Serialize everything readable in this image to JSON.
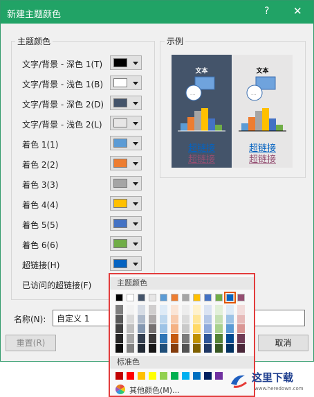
{
  "window": {
    "title": "新建主题颜色",
    "help_label": "?",
    "close_label": "✕"
  },
  "theme_group": {
    "title": "主题颜色",
    "rows": [
      {
        "label": "文字/背景 - 深色 1(T)",
        "color": "#000000"
      },
      {
        "label": "文字/背景 - 浅色 1(B)",
        "color": "#ffffff"
      },
      {
        "label": "文字/背景 - 深色 2(D)",
        "color": "#44546a"
      },
      {
        "label": "文字/背景 - 浅色 2(L)",
        "color": "#e7e6e6"
      },
      {
        "label": "着色 1(1)",
        "color": "#5b9bd5"
      },
      {
        "label": "着色 2(2)",
        "color": "#ed7d31"
      },
      {
        "label": "着色 3(3)",
        "color": "#a5a5a5"
      },
      {
        "label": "着色 4(4)",
        "color": "#ffc000"
      },
      {
        "label": "着色 5(5)",
        "color": "#4472c4"
      },
      {
        "label": "着色 6(6)",
        "color": "#70ad47"
      },
      {
        "label": "超链接(H)",
        "color": "#0563c1"
      },
      {
        "label": "已访问的超链接(F)",
        "color": "#954f72"
      }
    ]
  },
  "sample_group": {
    "title": "示例",
    "dark_panel": {
      "text": "文本",
      "link": "超链接",
      "visited": "超链接"
    },
    "light_panel": {
      "text": "文本",
      "link": "超链接",
      "visited": "超链接"
    }
  },
  "name_field": {
    "label": "名称(N):",
    "value": "自定义 1"
  },
  "buttons": {
    "reset": "重置(R)",
    "cancel": "取消"
  },
  "color_popup": {
    "theme_header": "主题颜色",
    "standard_header": "标准色",
    "more_colors": "其他颜色(M)...",
    "theme_colors": [
      "#000000",
      "#ffffff",
      "#44546a",
      "#e7e6e6",
      "#5b9bd5",
      "#ed7d31",
      "#a5a5a5",
      "#ffc000",
      "#4472c4",
      "#70ad47",
      "#0563c1",
      "#954f72"
    ],
    "shades": [
      [
        "#7f7f7f",
        "#595959",
        "#404040",
        "#262626",
        "#0d0d0d"
      ],
      [
        "#f2f2f2",
        "#d9d9d9",
        "#bfbfbf",
        "#a6a6a6",
        "#808080"
      ],
      [
        "#d6dce5",
        "#adb9ca",
        "#8497b0",
        "#333f50",
        "#222a35"
      ],
      [
        "#d0cece",
        "#aeaaaa",
        "#767171",
        "#3b3838",
        "#171616"
      ],
      [
        "#deebf7",
        "#bdd7ee",
        "#9dc3e6",
        "#2e75b6",
        "#1f4e79"
      ],
      [
        "#fbe5d6",
        "#f8cbad",
        "#f4b183",
        "#c55a11",
        "#843c0c"
      ],
      [
        "#ededed",
        "#dbdbdb",
        "#c9c9c9",
        "#7b7b7b",
        "#525252"
      ],
      [
        "#fff2cc",
        "#ffe699",
        "#ffd966",
        "#bf9000",
        "#7f6000"
      ],
      [
        "#dae3f3",
        "#b4c7e7",
        "#8faadc",
        "#2f5597",
        "#203864"
      ],
      [
        "#e2f0d9",
        "#c5e0b4",
        "#a9d18e",
        "#548235",
        "#385723"
      ],
      [
        "#deebf7",
        "#9dc3e6",
        "#5b9bd5",
        "#034a90",
        "#023160"
      ],
      [
        "#f2dcdb",
        "#e6b9b8",
        "#d99694",
        "#6f3b55",
        "#4a2739"
      ]
    ],
    "standard_colors": [
      "#c00000",
      "#ff0000",
      "#ffc000",
      "#ffff00",
      "#92d050",
      "#00b050",
      "#00b0f0",
      "#0070c0",
      "#002060",
      "#7030a0"
    ]
  },
  "watermark": {
    "text": "这里下载",
    "url_text": "www.heredown.com"
  }
}
